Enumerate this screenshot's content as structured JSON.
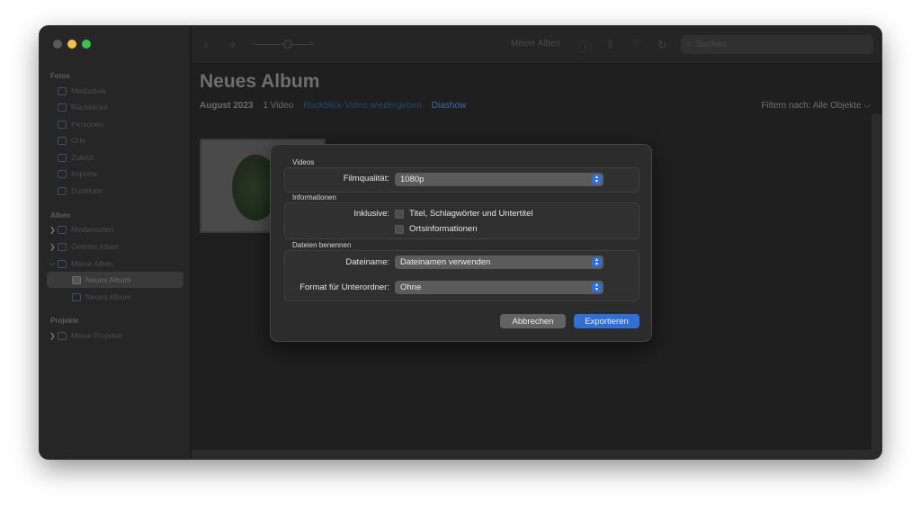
{
  "sidebar": {
    "section_fotos": "Fotos",
    "items_fotos": [
      "Mediathek",
      "Rückblicke",
      "Personen",
      "Orte",
      "Zuletzt",
      "Importe",
      "Duplikate"
    ],
    "section_alben": "Alben",
    "items_alben": [
      "Medienarten",
      "Geteilte Alben",
      "Meine Alben",
      "Neues Album",
      "Neues Album"
    ],
    "section_projekte": "Projekte",
    "items_projekte": [
      "Meine Projekte"
    ]
  },
  "toolbar": {
    "album_selector": "Meine Alben",
    "search_placeholder": "Suchen",
    "icons": [
      "back-icon",
      "crop-icon",
      "zoom-slider",
      "info-icon",
      "share-icon",
      "heart-icon",
      "rotate-icon",
      "search-icon"
    ]
  },
  "content": {
    "title": "Neues Album",
    "date": "August 2023",
    "count": "1 Video",
    "link_memory": "Rückblick-Video wiedergeben",
    "link_slideshow": "Diashow",
    "filter": "Filtern nach: Alle Objekte"
  },
  "dialog": {
    "group_videos": "Videos",
    "label_quality": "Filmqualität:",
    "value_quality": "1080p",
    "group_info": "Informationen",
    "label_include": "Inklusive:",
    "check_titles": "Titel, Schlagwörter und Untertitel",
    "check_location": "Ortsinformationen",
    "group_naming": "Dateien benennen",
    "label_filename": "Dateiname:",
    "value_filename": "Dateinamen verwenden",
    "label_subfolder": "Format für Unterordner:",
    "value_subfolder": "Ohne",
    "button_cancel": "Abbrechen",
    "button_export": "Exportieren"
  },
  "colors": {
    "accent": "#2f6fd6",
    "traffic_close": "#5a5a5a",
    "traffic_minimize": "#f5bd4f",
    "traffic_maximize": "#3cc24a"
  }
}
